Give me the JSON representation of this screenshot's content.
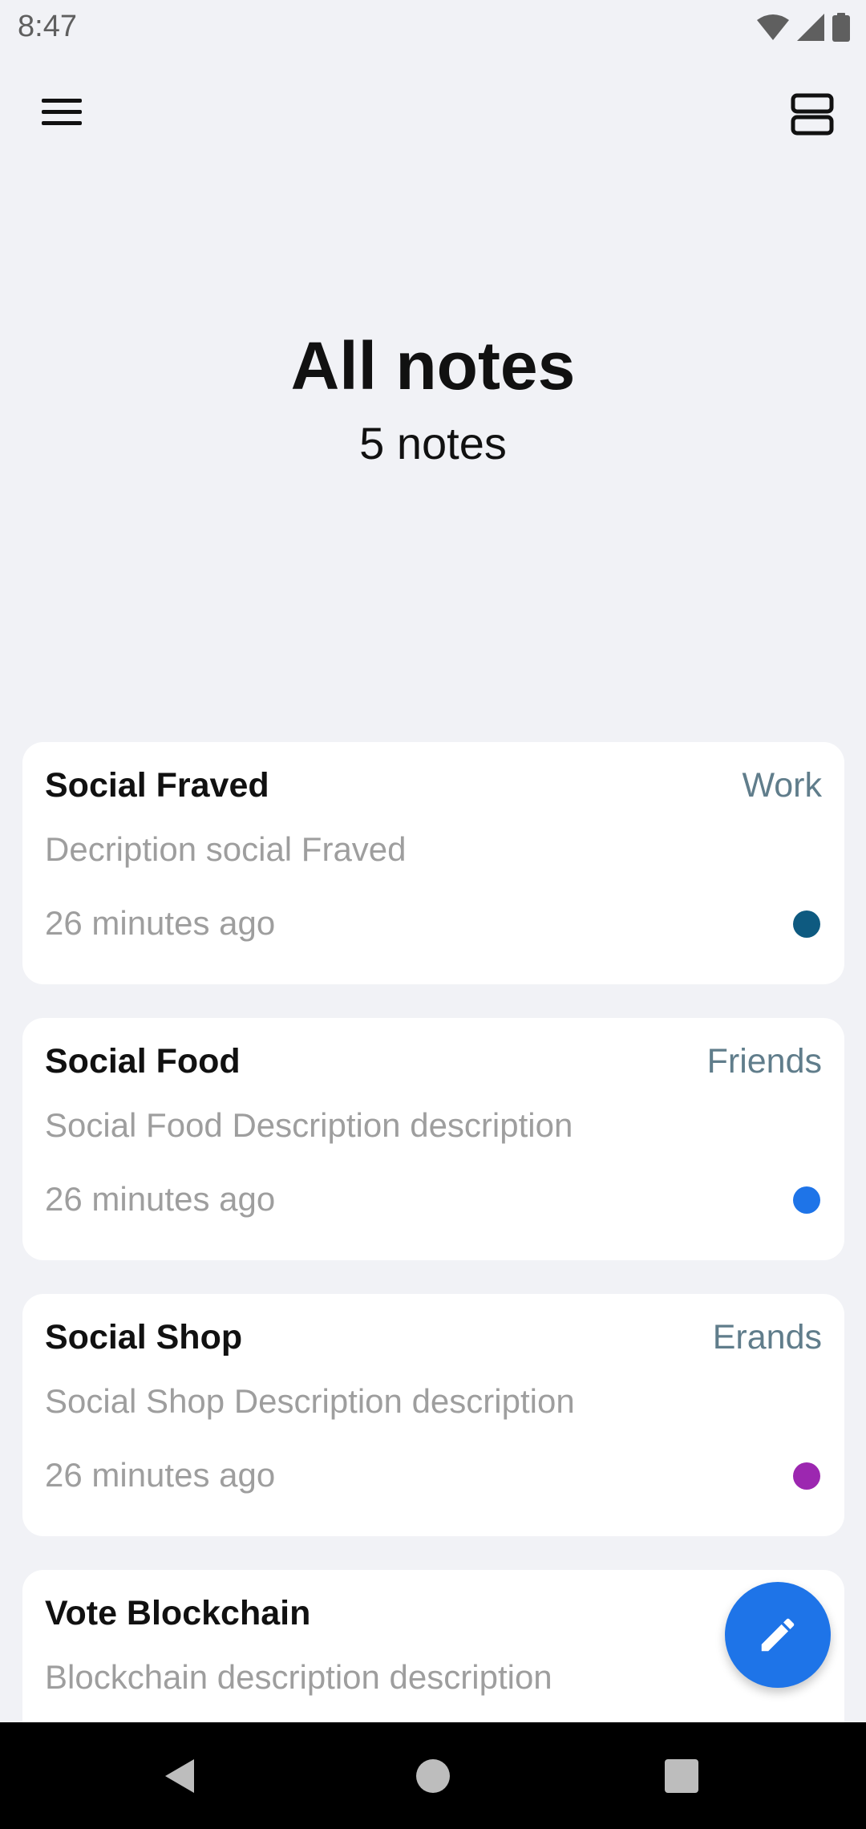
{
  "status_bar": {
    "time": "8:47",
    "icons": [
      "wifi-icon",
      "signal-icon",
      "battery-icon"
    ]
  },
  "app_bar": {
    "menu_icon": "menu-icon",
    "layout_icon": "view-agenda-icon"
  },
  "header": {
    "title": "All notes",
    "count": "5 notes"
  },
  "notes": [
    {
      "title": "Social Fraved",
      "category": "Work",
      "description": "Decription social Fraved",
      "time": "26 minutes ago",
      "color": "#0e5a80"
    },
    {
      "title": "Social Food",
      "category": "Friends",
      "description": "Social Food Description description",
      "time": "26 minutes ago",
      "color": "#1e74e8"
    },
    {
      "title": "Social Shop",
      "category": "Erands",
      "description": "Social Shop Description description",
      "time": "26 minutes ago",
      "color": "#9c27b0"
    },
    {
      "title": "Vote Blockchain",
      "category": "",
      "description": "Blockchain description description",
      "time": "",
      "color": ""
    }
  ],
  "fab": {
    "icon": "edit-pencil-icon",
    "color": "#1e74e8"
  },
  "nav_bar": {
    "back_icon": "back-triangle-icon",
    "home_icon": "home-circle-icon",
    "recents_icon": "recents-square-icon"
  }
}
